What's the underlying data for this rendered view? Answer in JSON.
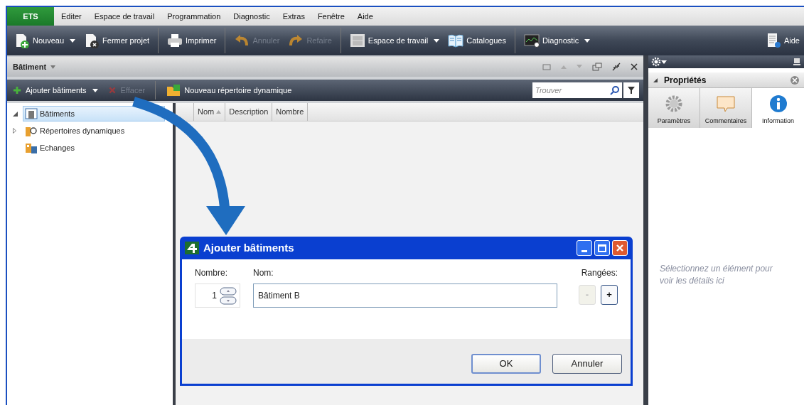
{
  "app_button": "ETS",
  "menu": [
    "Editer",
    "Espace de travail",
    "Programmation",
    "Diagnostic",
    "Extras",
    "Fenêtre",
    "Aide"
  ],
  "toolbar": [
    {
      "kind": "new",
      "label": "Nouveau",
      "dropdown": true,
      "disabled": false
    },
    {
      "kind": "close-project",
      "label": "Fermer projet",
      "dropdown": false,
      "disabled": false
    },
    {
      "kind": "print",
      "label": "Imprimer",
      "dropdown": false,
      "disabled": false
    },
    {
      "kind": "undo",
      "label": "Annuler",
      "dropdown": false,
      "disabled": true
    },
    {
      "kind": "redo",
      "label": "Refaire",
      "dropdown": false,
      "disabled": true
    },
    {
      "kind": "workspace",
      "label": "Espace de travail",
      "dropdown": true,
      "disabled": false
    },
    {
      "kind": "catalog",
      "label": "Catalogues",
      "dropdown": false,
      "disabled": false
    },
    {
      "kind": "diagnostic",
      "label": "Diagnostic",
      "dropdown": true,
      "disabled": false
    },
    {
      "kind": "help",
      "label": "Aide",
      "dropdown": false,
      "disabled": false
    }
  ],
  "panel": {
    "title": "Bâtiment",
    "actions": [
      {
        "kind": "add",
        "label": "Ajouter bâtiments",
        "dropdown": true,
        "disabled": false
      },
      {
        "kind": "delete",
        "label": "Effacer",
        "dropdown": false,
        "disabled": true
      },
      {
        "kind": "folder",
        "label": "Nouveau répertoire dynamique",
        "dropdown": false,
        "disabled": false
      }
    ],
    "search": {
      "placeholder": "Trouver"
    },
    "tree": [
      {
        "kind": "buildings",
        "label": "Bâtiments",
        "expandable": true,
        "expanded": true,
        "selected": true
      },
      {
        "kind": "dynamic",
        "label": "Répertoires dynamiques",
        "expandable": true,
        "expanded": false,
        "selected": false
      },
      {
        "kind": "exchanges",
        "label": "Echanges",
        "expandable": false,
        "selected": false
      }
    ],
    "columns": [
      {
        "label": "Nom",
        "sorted": true
      },
      {
        "label": "Description",
        "sorted": false
      },
      {
        "label": "Nombre",
        "sorted": false
      }
    ]
  },
  "properties": {
    "title": "Propriétés",
    "tabs": [
      {
        "kind": "gear",
        "label": "Paramètres",
        "selected": false
      },
      {
        "kind": "comment",
        "label": "Commentaires",
        "selected": false
      },
      {
        "kind": "info",
        "label": "Information",
        "selected": true
      }
    ],
    "message_lines": [
      "Sélectionnez un élément pour",
      "voir les détails ici"
    ]
  },
  "dialog": {
    "title": "Ajouter bâtiments",
    "count_label": "Nombre:",
    "count_value": "1",
    "name_label": "Nom:",
    "name_value": "Bâtiment B",
    "rows_label": "Rangées:",
    "row_buttons": [
      {
        "label": "-",
        "disabled": true
      },
      {
        "label": "+",
        "disabled": false
      }
    ],
    "buttons": [
      {
        "label": "OK",
        "default": true
      },
      {
        "label": "Annuler",
        "default": false
      }
    ]
  }
}
